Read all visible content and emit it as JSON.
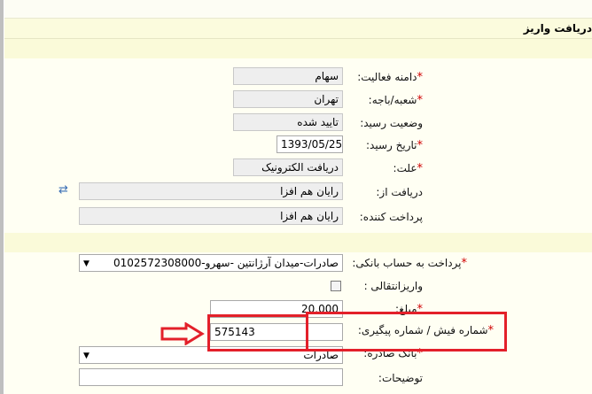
{
  "form": {
    "title": "دریافت واریز",
    "fields": {
      "activity_domain": {
        "label": "دامنه فعالیت:",
        "value": "سهام",
        "required": true
      },
      "branch": {
        "label": "شعبه/باجه:",
        "value": "تهران",
        "required": true
      },
      "receipt_status": {
        "label": "وضعیت رسید:",
        "value": "تایید شده",
        "required": false
      },
      "receipt_date": {
        "label": "تاریخ رسید:",
        "value": "1393/05/25",
        "required": true
      },
      "reason": {
        "label": "علت:",
        "value": "دریافت الکترونیک",
        "required": true
      },
      "received_from": {
        "label": "دریافت از:",
        "value": "رایان هم افزا",
        "required": false
      },
      "payer": {
        "label": "پرداخت کننده:",
        "value": "رایان هم افزا",
        "required": false
      },
      "bank_account": {
        "label": "پرداخت به حساب بانکی:",
        "value": "صادرات-میدان آرژانتین -سهرو-0102572308000",
        "required": true
      },
      "transfer": {
        "label": "واریزانتقالی :",
        "checked": false,
        "required": false
      },
      "amount": {
        "label": "مبلغ:",
        "value": "20,000",
        "required": true
      },
      "tracking_number": {
        "label": "شماره فیش / شماره پیگیری:",
        "value": "575143",
        "required": true
      },
      "issuing_bank": {
        "label": "بانک صادره:",
        "value": "صادرات",
        "required": true
      },
      "description": {
        "label": "توضیحات:",
        "value": "",
        "required": false
      }
    }
  },
  "colors": {
    "required_star": "#d00000",
    "highlight": "#e3202a",
    "form_bg": "#fffff3",
    "band_bg": "#fafad9"
  },
  "icons": {
    "swap": "swap-arrows-icon",
    "dropdown": "chevron-down-icon",
    "pointer": "right-arrow-icon"
  }
}
